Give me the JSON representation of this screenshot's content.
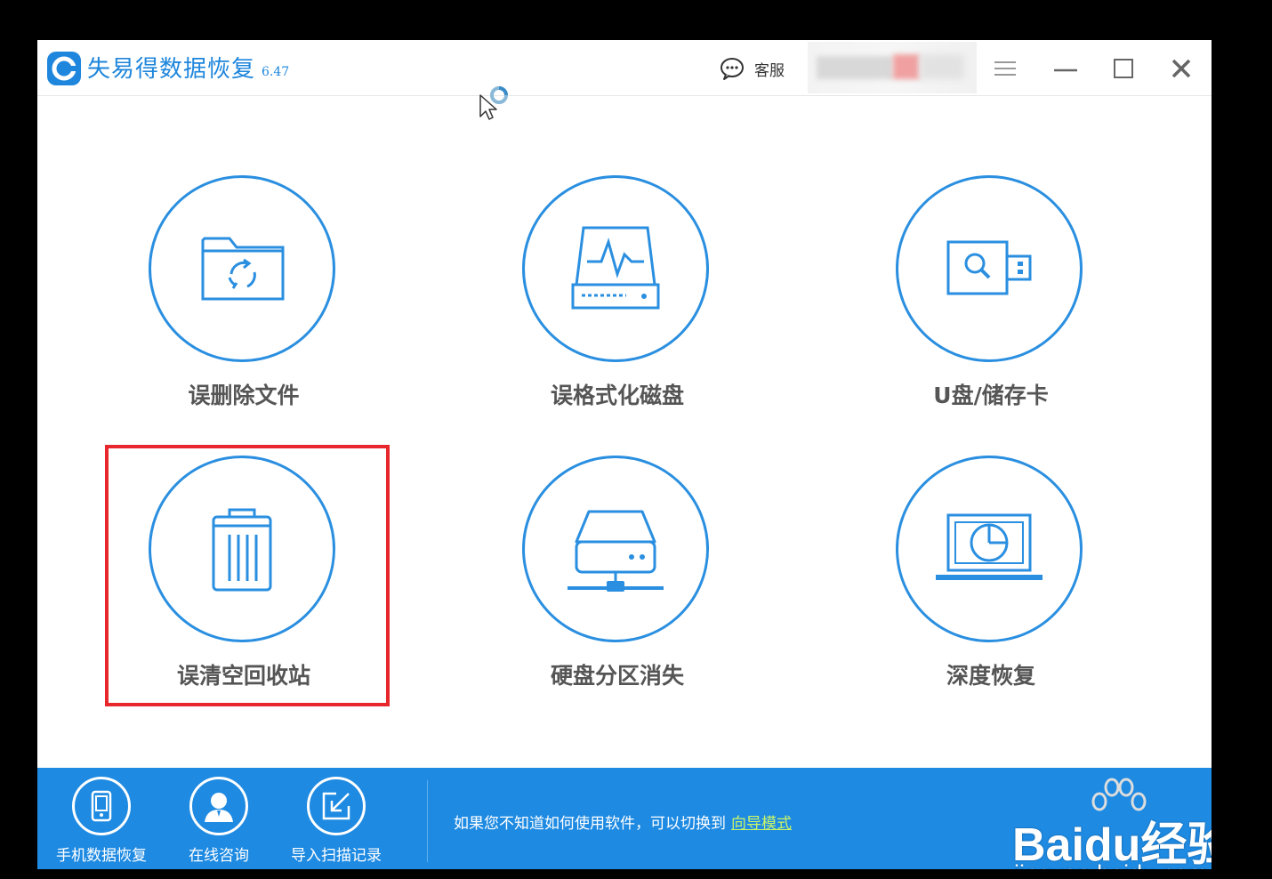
{
  "app": {
    "title": "失易得数据恢复",
    "version": "6.47"
  },
  "titlebar": {
    "support_label": "客服"
  },
  "tiles": [
    {
      "label": "误删除文件",
      "icon": "folder-recycle-icon"
    },
    {
      "label": "误格式化磁盘",
      "icon": "disk-pulse-icon"
    },
    {
      "label": "U盘/储存卡",
      "icon": "usb-drive-icon"
    },
    {
      "label": "误清空回收站",
      "icon": "trash-bin-icon"
    },
    {
      "label": "硬盘分区消失",
      "icon": "network-drive-icon"
    },
    {
      "label": "深度恢复",
      "icon": "laptop-scan-icon"
    }
  ],
  "footer": {
    "buttons": [
      {
        "label": "手机数据恢复",
        "icon": "phone-icon"
      },
      {
        "label": "在线咨询",
        "icon": "user-icon"
      },
      {
        "label": "导入扫描记录",
        "icon": "import-icon"
      }
    ],
    "hint": "如果您不知道如何使用软件，可以切换到",
    "hint_link": "向导模式"
  },
  "watermark": {
    "brand": "Bai",
    "brand_suffix": "经验",
    "site": "jingyan.baidu.com"
  },
  "colors": {
    "accent": "#1e8ae2",
    "highlight": "#e8272c",
    "link": "#c8f56a"
  }
}
